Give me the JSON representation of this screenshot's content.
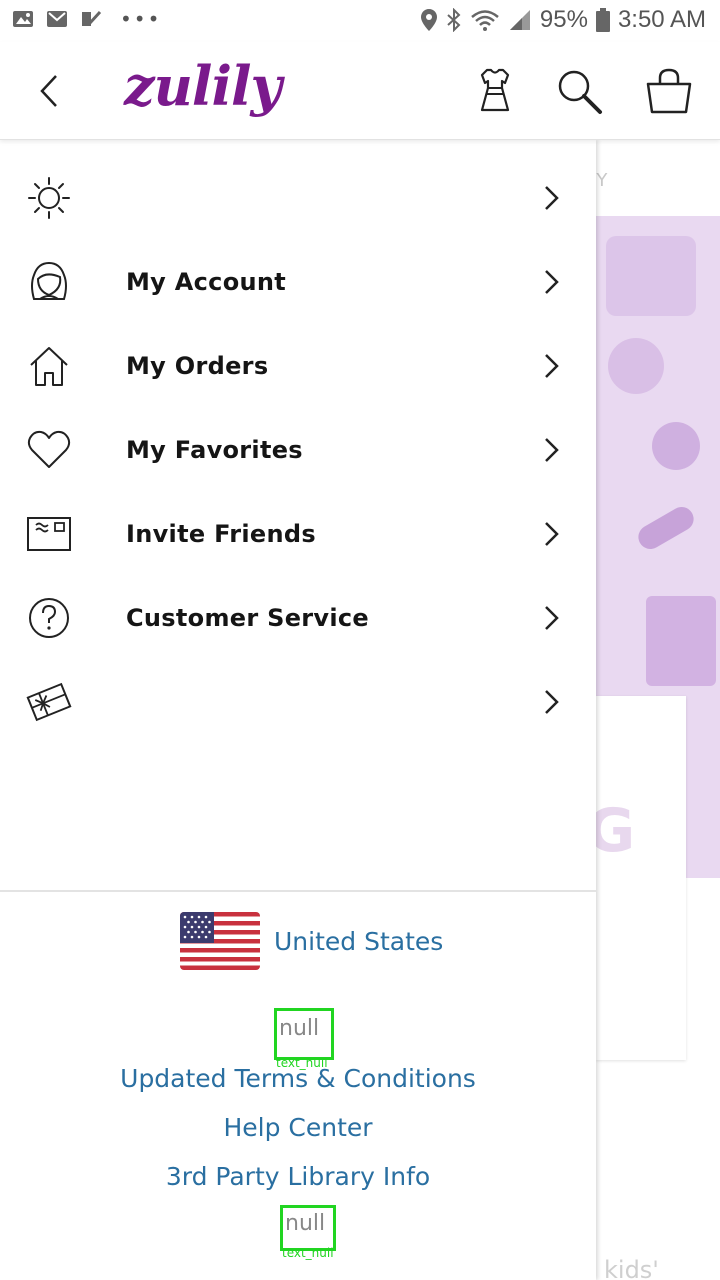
{
  "status_bar": {
    "battery": "95%",
    "time": "3:50 AM",
    "more": "•••"
  },
  "header": {
    "logo": "zulily",
    "icons": [
      "back-chevron-icon",
      "dress-icon",
      "search-icon",
      "shopping-bag-icon"
    ]
  },
  "background_page": {
    "tab_text": "VY",
    "card_letter": "G",
    "bottom_text": "kids'",
    "hero_color": "#e9d9f1"
  },
  "drawer": {
    "menu": [
      {
        "label": "",
        "icon": "sun-icon"
      },
      {
        "label": "My Account",
        "icon": "account-face-icon"
      },
      {
        "label": "My Orders",
        "icon": "home-icon"
      },
      {
        "label": "My Favorites",
        "icon": "heart-icon"
      },
      {
        "label": "Invite Friends",
        "icon": "invite-card-icon"
      },
      {
        "label": "Customer Service",
        "icon": "question-circle-icon"
      },
      {
        "label": "",
        "icon": "gift-card-icon"
      }
    ],
    "country": "United States",
    "null_label_1": "null",
    "null_tag_1": "text_null",
    "links": {
      "terms": "Updated Terms & Conditions",
      "help": "Help Center",
      "library": "3rd Party Library Info"
    },
    "null_label_2": "null",
    "null_tag_2": "text_null"
  },
  "colors": {
    "brand_purple": "#7a1a8c",
    "link_blue": "#2a6fa1",
    "debug_green": "#21d521"
  }
}
